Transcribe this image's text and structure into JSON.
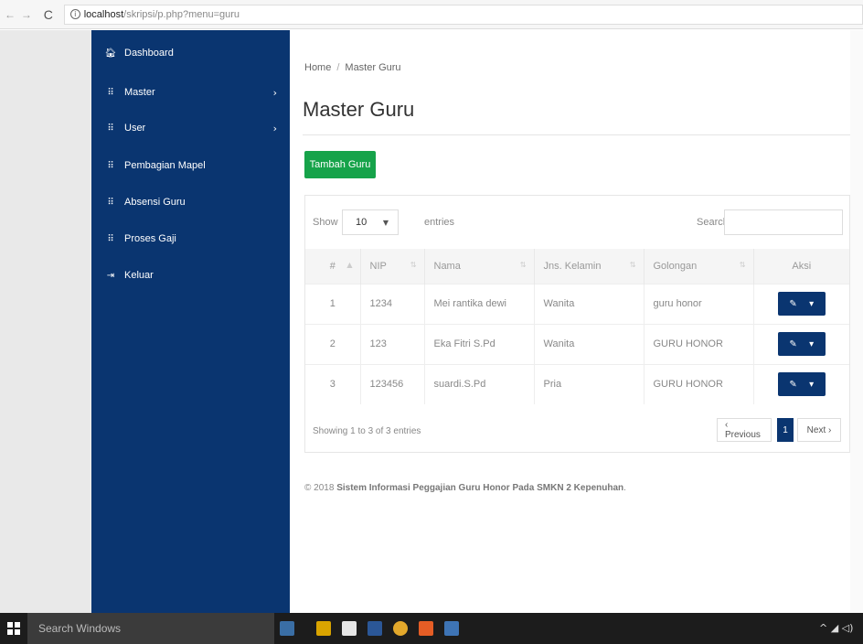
{
  "browser": {
    "url_host": "localhost",
    "url_path": "/skripsi/p.php?menu=guru"
  },
  "sidebar": {
    "items": [
      {
        "label": "Dashboard",
        "icon": "home-icon",
        "has_submenu": false
      },
      {
        "label": "Master",
        "icon": "grid-icon",
        "has_submenu": true
      },
      {
        "label": "User",
        "icon": "grid-icon",
        "has_submenu": true
      },
      {
        "label": "Pembagian Mapel",
        "icon": "grid-icon",
        "has_submenu": false
      },
      {
        "label": "Absensi Guru",
        "icon": "grid-icon",
        "has_submenu": false
      },
      {
        "label": "Proses Gaji",
        "icon": "grid-icon",
        "has_submenu": false
      },
      {
        "label": "Keluar",
        "icon": "logout-icon",
        "has_submenu": false
      }
    ]
  },
  "breadcrumb": {
    "home": "Home",
    "sep": "/",
    "current": "Master Guru"
  },
  "page": {
    "title": "Master Guru",
    "add_button": "Tambah Guru"
  },
  "table_controls": {
    "show": "Show",
    "length": "10",
    "entries": "entries",
    "search": "Search:"
  },
  "table": {
    "headers": [
      "#",
      "NIP",
      "Nama",
      "Jns. Kelamin",
      "Golongan",
      "Aksi"
    ],
    "rows": [
      [
        "1",
        "1234",
        "Mei rantika dewi",
        "Wanita",
        "guru honor"
      ],
      [
        "2",
        "123",
        "Eka Fitri S.Pd",
        "Wanita",
        "GURU HONOR"
      ],
      [
        "3",
        "123456",
        "suardi.S.Pd",
        "Pria",
        "GURU HONOR"
      ]
    ]
  },
  "table_info": "Showing 1 to 3 of 3 entries",
  "pagination": {
    "previous": "‹ Previous",
    "page": "1",
    "next": "Next ›"
  },
  "footer": {
    "prefix": "© 2018",
    "text": "Sistem Informasi Peggajian Guru Honor Pada SMKN 2 Kepenuhan",
    "suffix": "."
  },
  "taskbar": {
    "search": "Search Windows"
  },
  "colors": {
    "sidebar": "#0a3570",
    "add_button": "#16a34a",
    "action_button": "#0a3570"
  }
}
